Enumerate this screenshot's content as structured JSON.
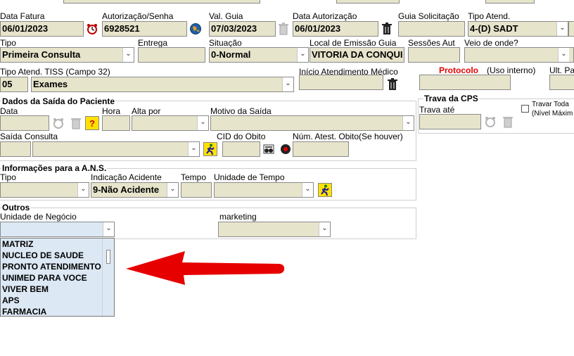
{
  "row1": {
    "data_fatura_label": "Data Fatura",
    "data_fatura_value": "06/01/2023",
    "autorizacao_label": "Autorização/Senha",
    "autorizacao_value": "6928521",
    "val_guia_label": "Val. Guia",
    "val_guia_value": "07/03/2023",
    "data_autorizacao_label": "Data Autorização",
    "data_autorizacao_value": "06/01/2023",
    "guia_solicitacao_label": "Guia Solicitação",
    "guia_solicitacao_value": "",
    "tipo_atend_label": "Tipo Atend.",
    "tipo_atend_value": "4-(D) SADT"
  },
  "row2": {
    "tipo_label": "Tipo",
    "tipo_value": "Primeira Consulta",
    "entrega_label": "Entrega",
    "entrega_value": "",
    "situacao_label": "Situação",
    "situacao_value": "0-Normal",
    "local_emissao_label": "Local de Emissão Guia",
    "local_emissao_value": "VITORIA DA CONQUI",
    "sessoes_label": "Sessões Aut",
    "sessoes_value": "",
    "veio_label": "Veio de onde?",
    "veio_value": ""
  },
  "row3": {
    "tipo_tiss_label": "Tipo Atend. TISS (Campo 32)",
    "tipo_tiss_code": "05",
    "tipo_tiss_value": "Exames",
    "inicio_label": "Início Atendimento Médico",
    "protocolo_label": "Protocolo",
    "uso_interno_label": "(Uso interno)",
    "ult_label": "Ult. Pa"
  },
  "saida": {
    "title": "Dados da Saída do Paciente",
    "data_label": "Data",
    "hora_label": "Hora",
    "alta_label": "Alta por",
    "motivo_label": "Motivo da Saída",
    "saida_consulta_label": "Saída Consulta",
    "cid_label": "CID do Obito",
    "atest_label": "Núm. Atest. Obito(Se houver)"
  },
  "trava": {
    "title": "Trava da CPS",
    "trava_ate_label": "Trava até",
    "travar_label": "Travar Toda",
    "nivel_label": "(Nível Máxim"
  },
  "ans": {
    "title": "Informações para a A.N.S.",
    "tipo_label": "Tipo",
    "indicacao_label": "Indicação Acidente",
    "indicacao_value": "9-Não Acidente",
    "tempo_label": "Tempo",
    "unidade_tempo_label": "Unidade de Tempo"
  },
  "outros": {
    "title": "Outros",
    "unidade_negocio_label": "Unidade de Negócio",
    "marketing_label": "marketing"
  },
  "dropdown": {
    "items": [
      "MATRIZ",
      "NUCLEO DE SAUDE",
      "PRONTO ATENDIMENTO",
      "UNIMED PARA VOCE",
      "VIVER BEM",
      "APS",
      "FARMACIA"
    ]
  },
  "colors": {
    "field_bg": "#e7e4cc",
    "dropdown_bg": "#dce8f4",
    "protocolo_red": "#e00000",
    "arrow_red": "#e60000"
  },
  "icons": [
    "alarm-clock-icon",
    "globe-icon",
    "trash-icon",
    "question-icon",
    "running-man-icon",
    "search-binoculars-icon",
    "record-icon",
    "chevron-down-icon"
  ]
}
